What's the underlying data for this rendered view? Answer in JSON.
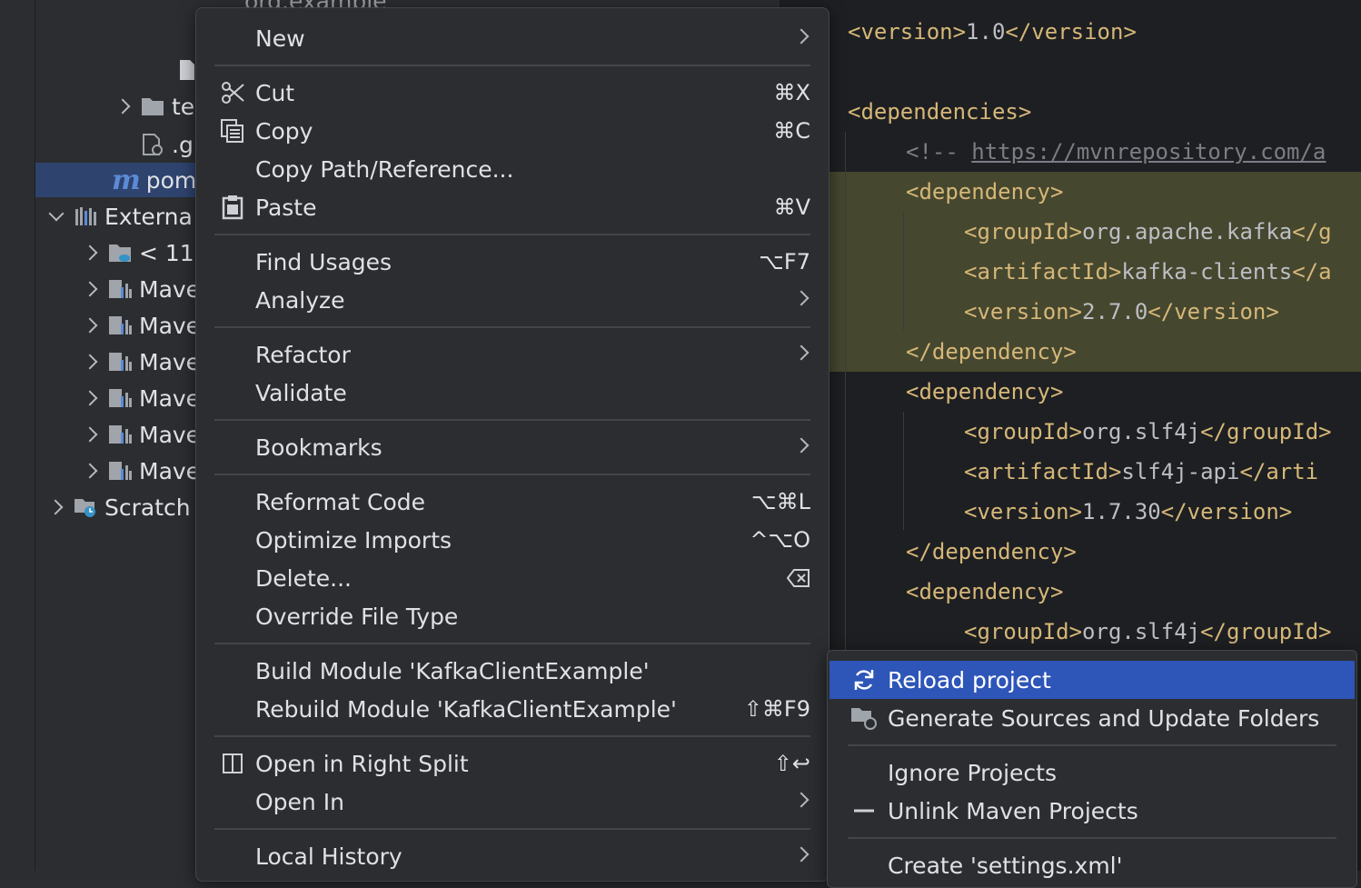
{
  "project_tree": {
    "top_partial": "org.example",
    "rows": [
      {
        "label": "te",
        "type": "folder",
        "expander": "right"
      },
      {
        "label": ".gitig",
        "type": "gitignore"
      },
      {
        "label": "pom",
        "type": "maven"
      },
      {
        "label": "Externa",
        "type": "libraries",
        "expander": "down"
      },
      {
        "label": "< 11",
        "type": "jdk",
        "expander": "right"
      },
      {
        "label": "Mave",
        "type": "maven-lib",
        "expander": "right"
      },
      {
        "label": "Mave",
        "type": "maven-lib",
        "expander": "right"
      },
      {
        "label": "Mave",
        "type": "maven-lib",
        "expander": "right"
      },
      {
        "label": "Mave",
        "type": "maven-lib",
        "expander": "right"
      },
      {
        "label": "Mave",
        "type": "maven-lib",
        "expander": "right"
      },
      {
        "label": "Mave",
        "type": "maven-lib",
        "expander": "right"
      },
      {
        "label": "Scratch",
        "type": "scratches",
        "expander": "right"
      }
    ]
  },
  "editor": {
    "lines": [
      {
        "open": "<version>",
        "text": "1.0",
        "close": "</version>"
      },
      {
        "open": "<dependencies>"
      },
      {
        "comment_start": "<!-- ",
        "url": "https://mvnrepository.com/a"
      },
      {
        "open": "<dependency>"
      },
      {
        "open": "<groupId>",
        "text": "org.apache.kafka",
        "close": "</g"
      },
      {
        "open": "<artifactId>",
        "text": "kafka-clients",
        "close": "</a"
      },
      {
        "open": "<version>",
        "text": "2.7.0",
        "close": "</version>"
      },
      {
        "open": "</dependency>"
      },
      {
        "open": "<dependency>"
      },
      {
        "open": "<groupId>",
        "text": "org.slf4j",
        "close": "</groupId>"
      },
      {
        "open": "<artifactId>",
        "text": "slf4j-api",
        "close": "</arti"
      },
      {
        "open": "<version>",
        "text": "1.7.30",
        "close": "</version>"
      },
      {
        "open": "</dependency>"
      },
      {
        "open": "<dependency>"
      },
      {
        "open": "<groupId>",
        "text": "org.slf4j",
        "close": "</groupId>"
      }
    ]
  },
  "context_menu": {
    "items": [
      {
        "label": "New",
        "submenu": true
      },
      {
        "label": "Cut",
        "shortcut": "⌘X",
        "icon": "scissors-icon"
      },
      {
        "label": "Copy",
        "shortcut": "⌘C",
        "icon": "copy-icon"
      },
      {
        "label": "Copy Path/Reference..."
      },
      {
        "label": "Paste",
        "shortcut": "⌘V",
        "icon": "paste-icon"
      },
      {
        "label": "Find Usages",
        "shortcut": "⌥F7"
      },
      {
        "label": "Analyze",
        "submenu": true
      },
      {
        "label": "Refactor",
        "submenu": true
      },
      {
        "label": "Validate"
      },
      {
        "label": "Bookmarks",
        "submenu": true
      },
      {
        "label": "Reformat Code",
        "shortcut": "⌥⌘L"
      },
      {
        "label": "Optimize Imports",
        "shortcut": "^⌥O"
      },
      {
        "label": "Delete...",
        "shortcut_icon": "delete-key-icon"
      },
      {
        "label": "Override File Type"
      },
      {
        "label": "Build Module 'KafkaClientExample'"
      },
      {
        "label": "Rebuild Module 'KafkaClientExample'",
        "shortcut": "⇧⌘F9"
      },
      {
        "label": "Open in Right Split",
        "shortcut": "⇧↩",
        "icon": "split-icon"
      },
      {
        "label": "Open In",
        "submenu": true
      },
      {
        "label": "Local History",
        "submenu": true
      }
    ]
  },
  "maven_submenu": {
    "items": [
      {
        "label": "Reload project",
        "icon": "reload-icon",
        "active": true
      },
      {
        "label": "Generate Sources and Update Folders",
        "icon": "generate-sources-icon"
      },
      {
        "label": "Ignore Projects"
      },
      {
        "label": "Unlink Maven Projects",
        "icon": "minus-icon"
      },
      {
        "label": "Create 'settings.xml'"
      }
    ]
  },
  "colors": {
    "background": "#2b2d30",
    "editor_background": "#1e1f22",
    "selection": "#2e436e",
    "active_item": "#2e55b8",
    "xml_tag": "#d5b778",
    "highlight": "#46472f"
  }
}
